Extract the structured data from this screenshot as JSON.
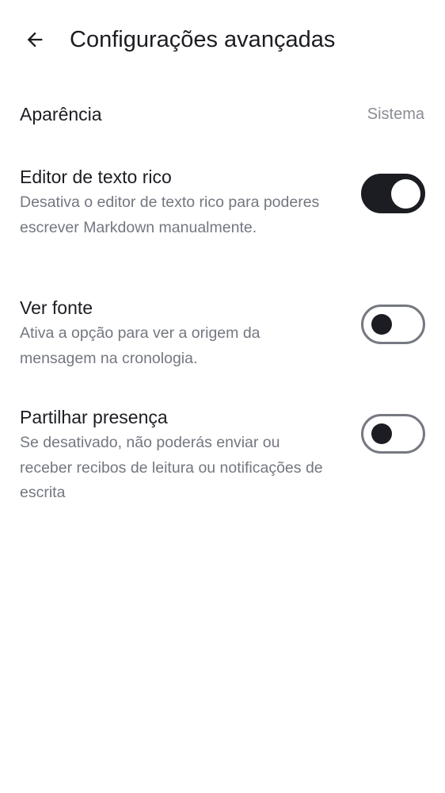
{
  "header": {
    "title": "Configurações avançadas",
    "back_icon": "arrow-left-icon"
  },
  "appearance": {
    "label": "Aparência",
    "value": "Sistema"
  },
  "rich_text": {
    "label": "Editor de texto rico",
    "description": "Desativa o editor de texto rico para poderes escrever Markdown manualmente.",
    "enabled": true
  },
  "view_source": {
    "label": "Ver fonte",
    "description": "Ativa a opção para ver a origem da mensagem na cronologia.",
    "enabled": false
  },
  "share_presence": {
    "label": "Partilhar presença",
    "description": "Se desativado, não poderás enviar ou receber recibos de leitura ou notificações de escrita",
    "enabled": false
  },
  "colors": {
    "text_primary": "#1b1d22",
    "text_secondary": "#737780",
    "switch_off_border": "#767981",
    "background": "#ffffff"
  }
}
